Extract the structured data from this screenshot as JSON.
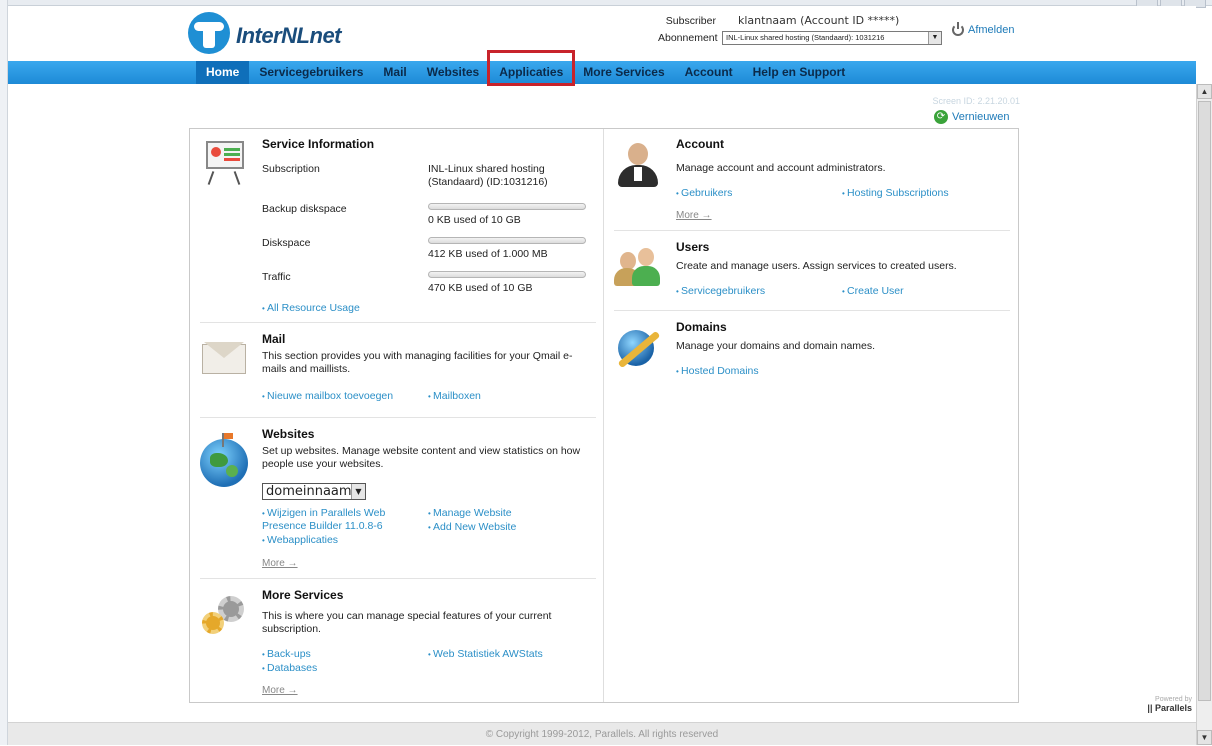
{
  "header": {
    "logo_text": "InterNLnet",
    "subscriber_label": "Subscriber",
    "subscriber_value": "klantnaam (Account ID *****)",
    "subscription_label": "Abonnement",
    "subscription_value": "INL-Linux shared hosting (Standaard): 1031216",
    "logout_label": "Afmelden"
  },
  "nav": {
    "items": [
      {
        "label": "Home"
      },
      {
        "label": "Servicegebruikers"
      },
      {
        "label": "Mail"
      },
      {
        "label": "Websites"
      },
      {
        "label": "Applicaties"
      },
      {
        "label": "More Services"
      },
      {
        "label": "Account"
      },
      {
        "label": "Help en Support"
      }
    ],
    "active": "Home",
    "highlighted": "Applicaties",
    "bar_color": "#2a9be2",
    "highlight_color": "#c8232b"
  },
  "screen_id": "Screen ID: 2.21.20.01",
  "refresh_label": "Vernieuwen",
  "service_info": {
    "title": "Service Information",
    "subscription_label": "Subscription",
    "subscription_value": "INL-Linux shared hosting (Standaard) (ID:1031216)",
    "backup_label": "Backup diskspace",
    "backup_value": "0 KB used of 10 GB",
    "backup_fraction": 0,
    "disk_label": "Diskspace",
    "disk_value": "412 KB used of 1.000 MB",
    "disk_fraction": 0,
    "traffic_label": "Traffic",
    "traffic_value": "470 KB used of 10 GB",
    "traffic_fraction": 0,
    "link_resource": "All Resource Usage"
  },
  "mail": {
    "title": "Mail",
    "desc": "This section provides you with managing facilities for your Qmail e-mails and maillists.",
    "link_new": "Nieuwe mailbox toevoegen",
    "link_boxes": "Mailboxen"
  },
  "websites": {
    "title": "Websites",
    "desc": "Set up websites. Manage website content and view statistics on how people use your websites.",
    "domain_select": "domeinnaam",
    "link_builder": "Wijzigen in Parallels Web Presence Builder 11.0.8-6",
    "link_webapps": "Webapplicaties",
    "link_manage": "Manage Website",
    "link_add": "Add New Website",
    "more": "More →"
  },
  "more_services": {
    "title": "More Services",
    "desc": "This is where you can manage special features of your current subscription.",
    "link_backups": "Back-ups",
    "link_databases": "Databases",
    "link_stats": "Web Statistiek AWStats",
    "more": "More →"
  },
  "account": {
    "title": "Account",
    "desc": "Manage account and account administrators.",
    "link_users": "Gebruikers",
    "link_subs": "Hosting Subscriptions",
    "more": "More →"
  },
  "users": {
    "title": "Users",
    "desc": "Create and manage users. Assign services to created users.",
    "link_service": "Servicegebruikers",
    "link_create": "Create User"
  },
  "domains": {
    "title": "Domains",
    "desc": "Manage your domains and domain names.",
    "link_hosted": "Hosted Domains"
  },
  "powered_by": {
    "line1": "Powered by",
    "brand": "|| Parallels"
  },
  "footer": "© Copyright 1999-2012, Parallels. All rights reserved"
}
